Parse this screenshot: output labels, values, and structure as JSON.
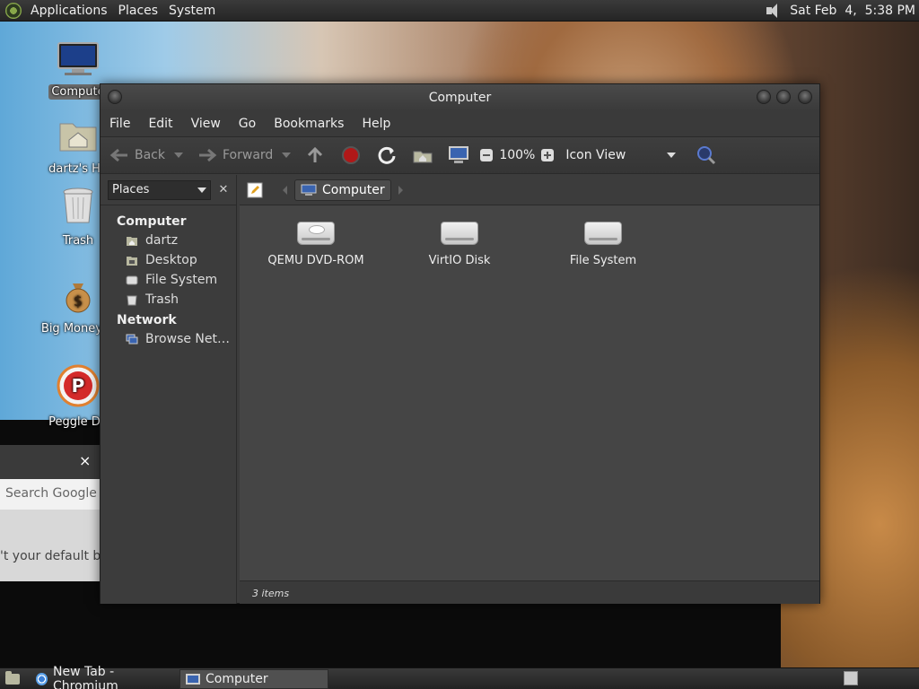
{
  "top_panel": {
    "menus": [
      "Applications",
      "Places",
      "System"
    ],
    "clock": "Sat Feb  4,  5:38 PM"
  },
  "desktop_icons": [
    {
      "label": "Compute",
      "selected": true,
      "icon": "computer-icon"
    },
    {
      "label": "dartz's Ho",
      "icon": "home-folder-icon"
    },
    {
      "label": "Trash",
      "icon": "trash-icon"
    },
    {
      "label": "Big Money D",
      "icon": "money-bag-icon"
    },
    {
      "label": "Peggle De",
      "icon": "peggle-icon"
    }
  ],
  "chromium_popup": {
    "search_placeholder": "Search Google or",
    "default_text": "'t your default bro",
    "close_label": "×"
  },
  "window": {
    "title": "Computer",
    "menu": [
      "File",
      "Edit",
      "View",
      "Go",
      "Bookmarks",
      "Help"
    ],
    "toolbar": {
      "back": "Back",
      "forward": "Forward",
      "zoom": "100%",
      "view_mode": "Icon View"
    },
    "sidebar": {
      "selector": "Places",
      "close": "✕",
      "sections": [
        {
          "title": "Computer",
          "items": [
            "dartz",
            "Desktop",
            "File System",
            "Trash"
          ]
        },
        {
          "title": "Network",
          "items": [
            "Browse Net…"
          ]
        }
      ]
    },
    "path": {
      "current": "Computer"
    },
    "items": [
      {
        "label": "QEMU DVD-ROM",
        "icon": "dvd-drive-icon"
      },
      {
        "label": "VirtIO Disk",
        "icon": "hard-disk-icon"
      },
      {
        "label": "File System",
        "icon": "hard-disk-icon"
      }
    ],
    "status": "3 items"
  },
  "taskbar": {
    "tasks": [
      {
        "label": "New Tab - Chromium",
        "icon": "chromium-icon",
        "active": false
      },
      {
        "label": "Computer",
        "icon": "computer-icon",
        "active": true
      }
    ]
  }
}
